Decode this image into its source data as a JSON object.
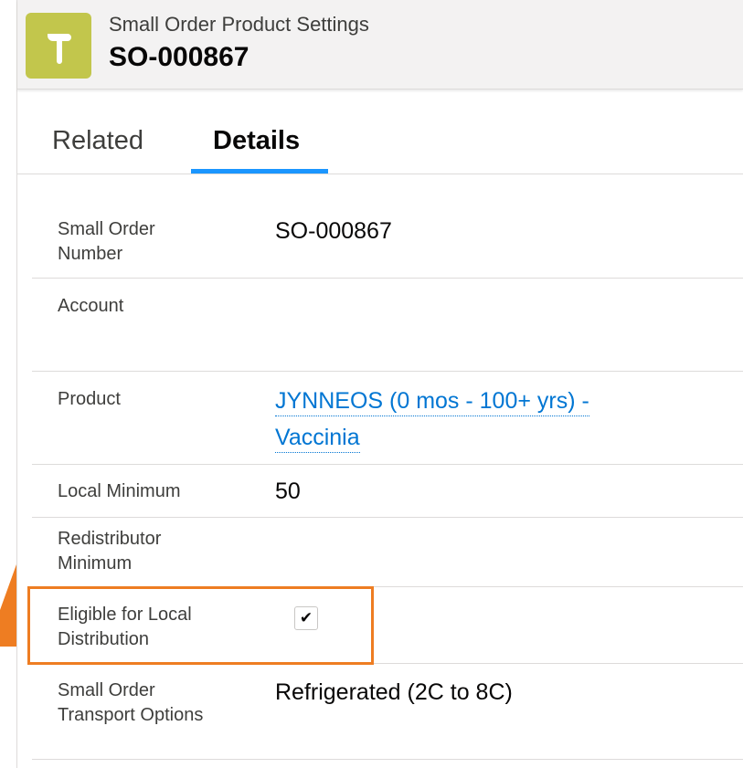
{
  "header": {
    "object_type": "Small Order Product Settings",
    "record_name": "SO-000867",
    "icon": "hammer-icon",
    "icon_color": "#c2c64c"
  },
  "tabs": [
    {
      "label": "Related",
      "active": false
    },
    {
      "label": "Details",
      "active": true
    }
  ],
  "details": {
    "small_order_number": {
      "label": "Small Order Number",
      "value": "SO-000867"
    },
    "account": {
      "label": "Account",
      "value": ""
    },
    "product": {
      "label": "Product",
      "value": "JYNNEOS (0 mos - 100+ yrs) - Vaccinia"
    },
    "local_minimum": {
      "label": "Local Minimum",
      "value": "50"
    },
    "redistributor_minimum": {
      "label": "Redistributor Minimum",
      "value": ""
    },
    "eligible_local_distribution": {
      "label": "Eligible for Local Distribution",
      "checked": true,
      "check_glyph": "✔"
    },
    "transport_options": {
      "label": "Small Order Transport Options",
      "value": "Refrigerated (2C to 8C)"
    }
  },
  "colors": {
    "accent": "#1b96ff",
    "link": "#0176d3",
    "highlight": "#ee7d22"
  }
}
